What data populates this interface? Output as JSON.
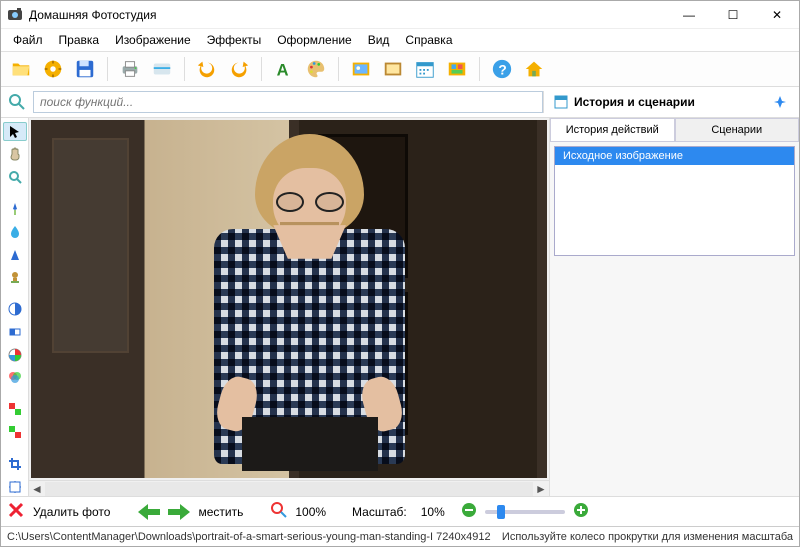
{
  "app": {
    "title": "Домашняя Фотостудия"
  },
  "win": {
    "min": "—",
    "max": "☐",
    "close": "✕"
  },
  "menu": [
    "Файл",
    "Правка",
    "Изображение",
    "Эффекты",
    "Оформление",
    "Вид",
    "Справка"
  ],
  "search": {
    "placeholder": "поиск функций..."
  },
  "history_panel": {
    "title": "История и сценарии",
    "tabs": {
      "actions": "История действий",
      "scenarios": "Сценарии"
    },
    "items": [
      "Исходное изображение"
    ]
  },
  "bottom": {
    "delete_photo": "Удалить фото",
    "move_label": "местить",
    "zoom_reset": "100%",
    "scale_label": "Масштаб:",
    "scale_value": "10%"
  },
  "status": {
    "path": "C:\\Users\\ContentManager\\Downloads\\portrait-of-a-smart-serious-young-man-standing-I 7240x4912",
    "hint": "Используйте колесо прокрутки для изменения масштаба"
  },
  "colors": {
    "accent": "#2d89ef"
  }
}
